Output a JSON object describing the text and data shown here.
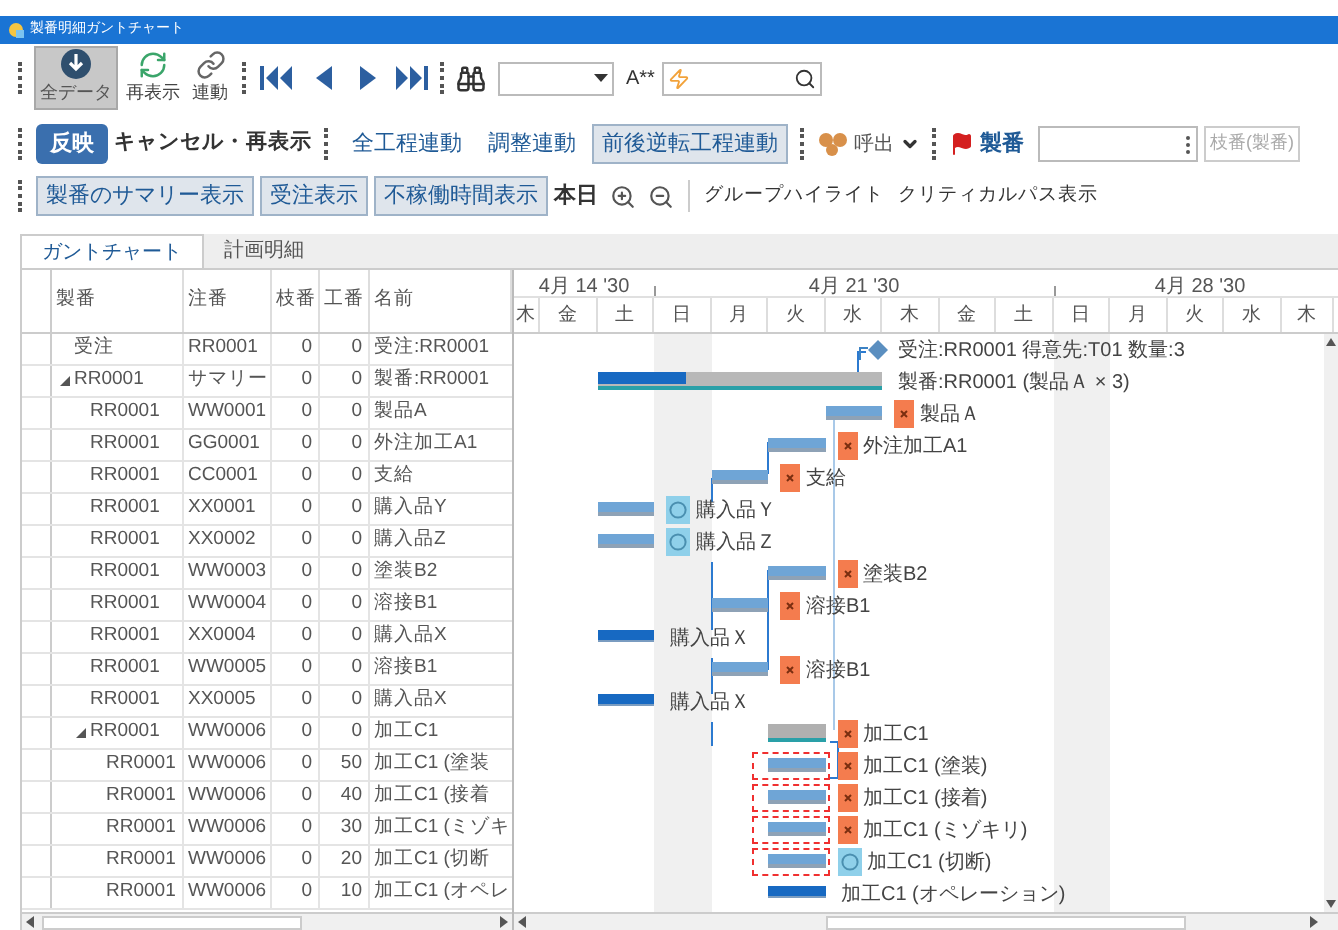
{
  "window": {
    "title": "製番明細ガントチャート"
  },
  "toolbar_1": {
    "big_buttons": [
      {
        "label": "全データ",
        "selected": true
      },
      {
        "label": "再表示",
        "selected": false
      },
      {
        "label": "連動",
        "selected": false
      }
    ],
    "font_button": "A**"
  },
  "toolbar_2": {
    "apply_button": "反映",
    "cancel_button": "キャンセル・再表示",
    "link_modes": [
      {
        "label": "全工程連動",
        "pressed": false
      },
      {
        "label": "調整連動",
        "pressed": false
      },
      {
        "label": "前後逆転工程連動",
        "pressed": true
      }
    ],
    "call_menu": "呼出",
    "seiban_label": "製番",
    "branch_button": {
      "label": "枝番(製番)",
      "disabled": true
    }
  },
  "toolbar_3": {
    "view_toggles": [
      {
        "label": "製番のサマリー表示",
        "pressed": true
      },
      {
        "label": "受注表示",
        "pressed": true
      },
      {
        "label": "不稼働時間表示",
        "pressed": true
      }
    ],
    "today_button": "本日",
    "links": [
      "グループハイライト",
      "クリティカルパス表示"
    ]
  },
  "tabs": [
    {
      "label": "ガントチャート",
      "selected": true
    },
    {
      "label": "計画明細",
      "selected": false
    }
  ],
  "grid": {
    "columns": [
      "製番",
      "注番",
      "枝番",
      "工番",
      "名前"
    ],
    "rows": [
      {
        "seiban": "受注",
        "chuban": "RR0001",
        "eda": "0",
        "koban": "0",
        "name": "受注:RR0001"
      },
      {
        "seiban": "RR0001",
        "chuban": "サマリー",
        "eda": "0",
        "koban": "0",
        "name": "製番:RR0001",
        "expanded": true,
        "children": [
          {
            "seiban": "RR0001",
            "chuban": "WW0001",
            "eda": "0",
            "koban": "0",
            "name": "製品A"
          },
          {
            "seiban": "RR0001",
            "chuban": "GG0001",
            "eda": "0",
            "koban": "0",
            "name": "外注加工A1"
          },
          {
            "seiban": "RR0001",
            "chuban": "CC0001",
            "eda": "0",
            "koban": "0",
            "name": "支給"
          },
          {
            "seiban": "RR0001",
            "chuban": "XX0001",
            "eda": "0",
            "koban": "0",
            "name": "購入品Y"
          },
          {
            "seiban": "RR0001",
            "chuban": "XX0002",
            "eda": "0",
            "koban": "0",
            "name": "購入品Z"
          },
          {
            "seiban": "RR0001",
            "chuban": "WW0003",
            "eda": "0",
            "koban": "0",
            "name": "塗装B2"
          },
          {
            "seiban": "RR0001",
            "chuban": "WW0004",
            "eda": "0",
            "koban": "0",
            "name": "溶接B1"
          },
          {
            "seiban": "RR0001",
            "chuban": "XX0004",
            "eda": "0",
            "koban": "0",
            "name": "購入品X"
          },
          {
            "seiban": "RR0001",
            "chuban": "WW0005",
            "eda": "0",
            "koban": "0",
            "name": "溶接B1"
          },
          {
            "seiban": "RR0001",
            "chuban": "XX0005",
            "eda": "0",
            "koban": "0",
            "name": "購入品X"
          },
          {
            "seiban": "RR0001",
            "chuban": "WW0006",
            "eda": "0",
            "koban": "0",
            "name": "加工C1",
            "expanded": true,
            "children": [
              {
                "seiban": "RR0001",
                "chuban": "WW0006",
                "eda": "0",
                "koban": "50",
                "name": "加工C1 (塗装"
              },
              {
                "seiban": "RR0001",
                "chuban": "WW0006",
                "eda": "0",
                "koban": "40",
                "name": "加工C1 (接着"
              },
              {
                "seiban": "RR0001",
                "chuban": "WW0006",
                "eda": "0",
                "koban": "30",
                "name": "加工C1 (ミゾキ"
              },
              {
                "seiban": "RR0001",
                "chuban": "WW0006",
                "eda": "0",
                "koban": "20",
                "name": "加工C1 (切断"
              },
              {
                "seiban": "RR0001",
                "chuban": "WW0006",
                "eda": "0",
                "koban": "10",
                "name": "加工C1 (オペレ"
              }
            ]
          }
        ]
      }
    ]
  },
  "gantt": {
    "weeks": [
      "4月 14 '30",
      "4月 21 '30",
      "4月 28 '30"
    ],
    "days": [
      {
        "label": "木",
        "non_working": false
      },
      {
        "label": "金",
        "non_working": false
      },
      {
        "label": "土",
        "non_working": false
      },
      {
        "label": "日",
        "non_working": true
      },
      {
        "label": "月",
        "non_working": false
      },
      {
        "label": "火",
        "non_working": false
      },
      {
        "label": "水",
        "non_working": false
      },
      {
        "label": "木",
        "non_working": false
      },
      {
        "label": "金",
        "non_working": false
      },
      {
        "label": "土",
        "non_working": false
      },
      {
        "label": "日",
        "non_working": true
      },
      {
        "label": "月",
        "non_working": false
      },
      {
        "label": "火",
        "non_working": false
      },
      {
        "label": "水",
        "non_working": false
      },
      {
        "label": "木",
        "non_working": false
      }
    ],
    "tasks": [
      {
        "kind": "milestone",
        "label": "受注:RR0001 得意先:T01 数量:3",
        "warning": false
      },
      {
        "kind": "summary",
        "label": "製番:RR0001 (製品Ａ × 3)",
        "warning": false,
        "level": 0.31
      },
      {
        "kind": "plan",
        "label": "製品Ａ",
        "marker": {
          "kind": "cross"
        },
        "warning": false
      },
      {
        "kind": "plan",
        "label": "外注加工A1",
        "marker": {
          "kind": "cross"
        },
        "warning": false
      },
      {
        "kind": "plan",
        "label": "支給",
        "marker": {
          "kind": "cross"
        },
        "warning": false
      },
      {
        "kind": "plan",
        "label": "購入品Ｙ",
        "marker": {
          "kind": "circle"
        },
        "warning": false
      },
      {
        "kind": "plan",
        "label": "購入品Ｚ",
        "marker": {
          "kind": "circle"
        },
        "warning": false
      },
      {
        "kind": "plan",
        "label": "塗装B2",
        "marker": {
          "kind": "cross"
        },
        "warning": false
      },
      {
        "kind": "plan",
        "label": "溶接B1",
        "marker": {
          "kind": "cross"
        },
        "warning": false
      },
      {
        "kind": "purchase",
        "label": "購入品Ｘ",
        "warning": false
      },
      {
        "kind": "plan",
        "label": "溶接B1",
        "marker": {
          "kind": "cross"
        },
        "warning": false
      },
      {
        "kind": "purchase",
        "label": "購入品Ｘ",
        "warning": false
      },
      {
        "kind": "group",
        "label": "加工C1",
        "marker": {
          "kind": "cross"
        },
        "warning": false
      },
      {
        "kind": "plan",
        "label": "加工C1 (塗装)",
        "marker": {
          "kind": "cross"
        },
        "warning": true
      },
      {
        "kind": "plan",
        "label": "加工C1 (接着)",
        "marker": {
          "kind": "cross"
        },
        "warning": true
      },
      {
        "kind": "plan",
        "label": "加工C1 (ミゾキリ)",
        "marker": {
          "kind": "cross"
        },
        "warning": true
      },
      {
        "kind": "plan",
        "label": "加工C1 (切断)",
        "marker": {
          "kind": "circle"
        },
        "warning": true
      },
      {
        "kind": "purchase",
        "label": "加工C1 (オペレーション)",
        "warning": false
      }
    ]
  }
}
